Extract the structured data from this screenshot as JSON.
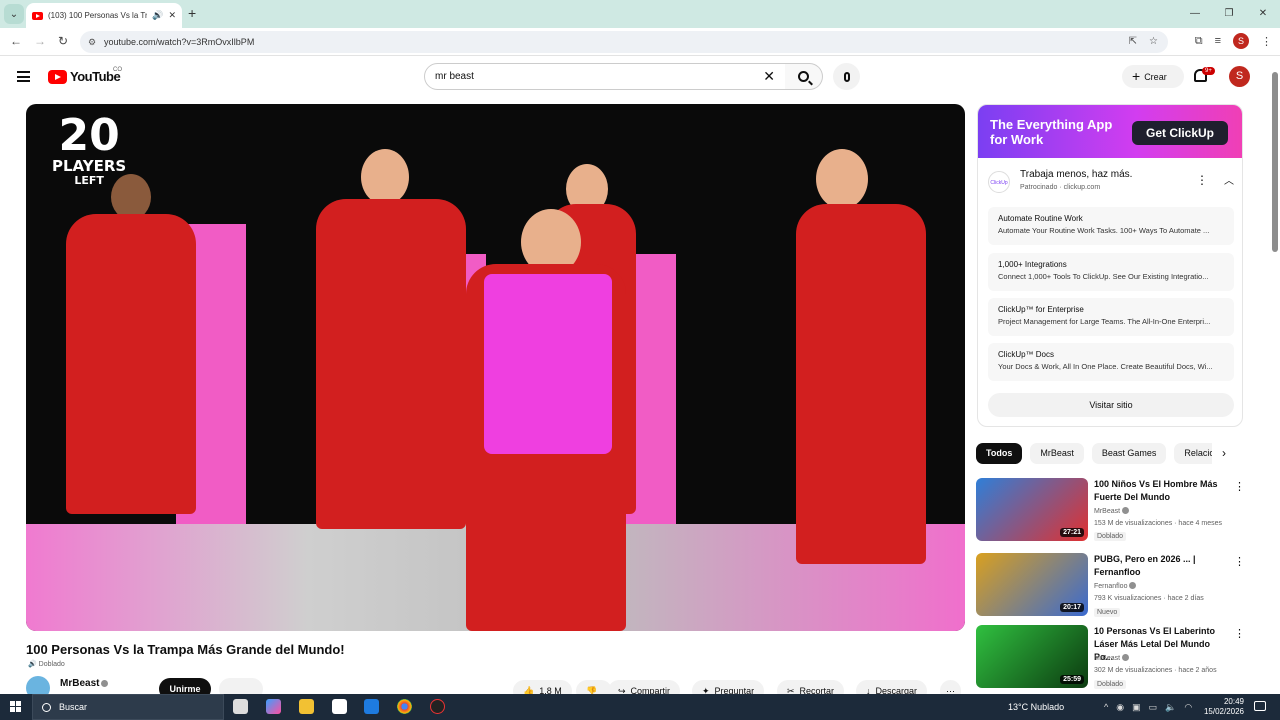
{
  "browser": {
    "tab_title": "(103) 100 Personas Vs la Tra",
    "url": "youtube.com/watch?v=3RmOvxIlbPM",
    "new_tab_symbol": "+"
  },
  "header": {
    "logo_text": "YouTube",
    "country_code": "CO",
    "search_value": "mr beast",
    "create_label": "Crear",
    "notification_count": "9+",
    "avatar_letter": "S"
  },
  "video": {
    "overlay_number": "20",
    "overlay_players": "PLAYERS",
    "overlay_left": "LEFT",
    "title": "100 Personas Vs la Trampa Más Grande del Mundo!",
    "dub_label": "Doblado",
    "channel": "MrBeast",
    "join_label": "Unirme",
    "likes": "1,8 M",
    "share_label": "Compartir",
    "ask_label": "Preguntar",
    "clip_label": "Recortar",
    "download_label": "Descargar"
  },
  "ad": {
    "banner_line1": "The Everything App",
    "banner_line2": "for Work",
    "banner_cta": "Get ClickUp",
    "logo_text": "ClickUp",
    "tagline": "Trabaja menos, haz más.",
    "sponsored": "Patrocinado · clickup.com",
    "items": [
      {
        "title": "Automate Routine Work",
        "desc": "Automate Your Routine Work Tasks. 100+ Ways To Automate ..."
      },
      {
        "title": "1,000+ Integrations",
        "desc": "Connect 1,000+ Tools To ClickUp. See Our Existing Integratio..."
      },
      {
        "title": "ClickUp™ for Enterprise",
        "desc": "Project Management for Large Teams. The All-In-One Enterpri..."
      },
      {
        "title": "ClickUp™ Docs",
        "desc": "Your Docs & Work, All In One Place. Create Beautiful Docs, Wi..."
      }
    ],
    "visit_label": "Visitar sitio"
  },
  "chips": [
    "Todos",
    "MrBeast",
    "Beast Games",
    "Relacionados"
  ],
  "related": [
    {
      "title": "100 Niños Vs El Hombre Más Fuerte Del Mundo",
      "channel": "MrBeast",
      "meta": "153 M de visualizaciones · hace 4 meses",
      "badge": "Doblado",
      "duration": "27:21",
      "thumb_colors": [
        "#2f7fd8",
        "#e03030"
      ]
    },
    {
      "title": "PUBG, Pero en 2026 ... | Fernanfloo",
      "channel": "Fernanfloo",
      "meta": "793 K visualizaciones · hace 2 días",
      "badge": "Nuevo",
      "duration": "20:17",
      "thumb_colors": [
        "#d9a020",
        "#3a6ad0"
      ]
    },
    {
      "title": "10 Personas Vs El Laberinto Láser Más Letal Del Mundo Po...",
      "channel": "MrBeast",
      "meta": "302 M de visualizaciones · hace 2 años",
      "badge": "Doblado",
      "duration": "25:59",
      "thumb_colors": [
        "#30c040",
        "#0c3a10"
      ]
    }
  ],
  "taskbar": {
    "search_placeholder": "Buscar",
    "weather": "13°C  Nublado",
    "time": "20:49",
    "date": "15/02/2026"
  }
}
